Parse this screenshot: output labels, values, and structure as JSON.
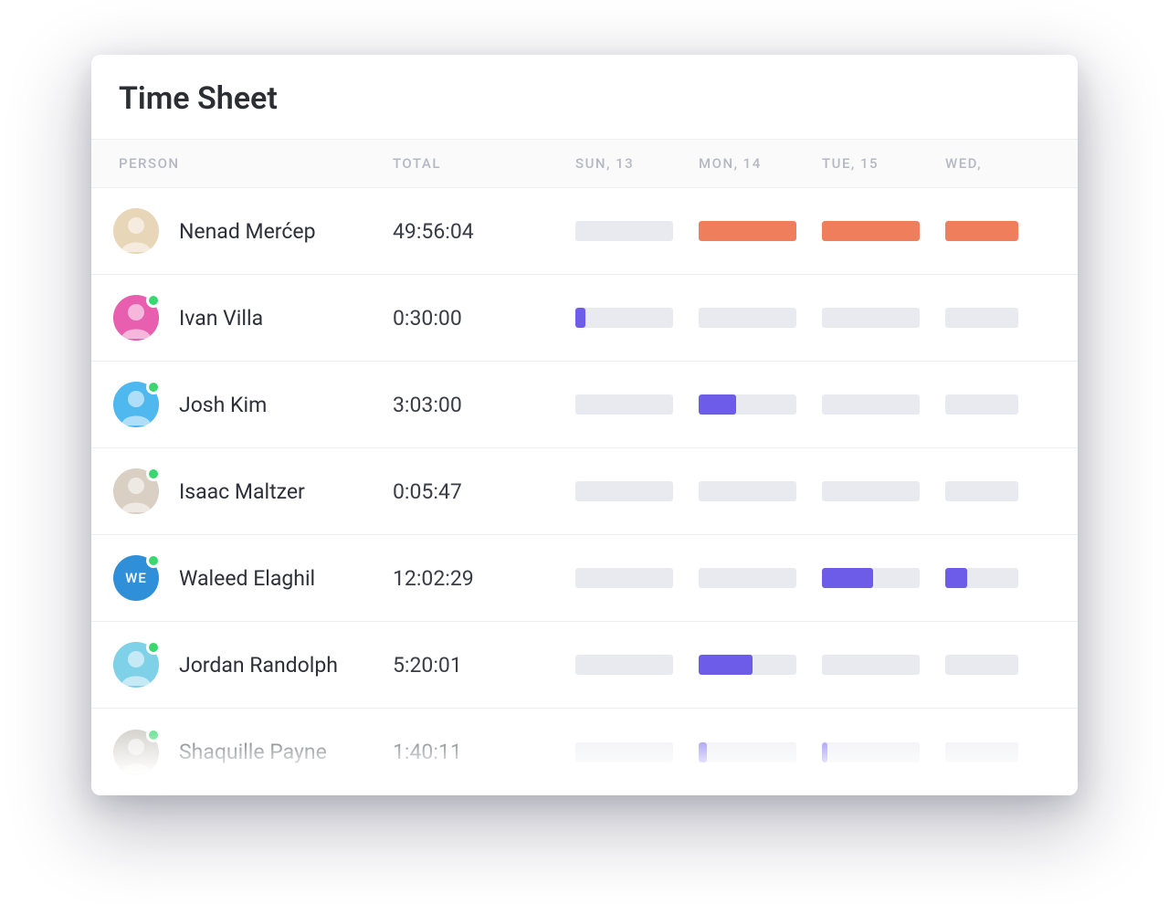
{
  "title": "Time Sheet",
  "columns": {
    "person": "PERSON",
    "total": "TOTAL",
    "days": [
      "SUN, 13",
      "MON, 14",
      "TUE, 15",
      "WED,"
    ]
  },
  "colors": {
    "orange": "#ee7e5c",
    "purple": "#6c5ce7",
    "track": "#e9eaf0",
    "presence": "#3ad66f"
  },
  "rows": [
    {
      "name": "Nenad Merćep",
      "total": "49:56:04",
      "avatar": {
        "type": "photo",
        "bg": "#e8d6b8",
        "initials": ""
      },
      "presence": false,
      "bars": [
        {
          "fill": 0,
          "color": "purple"
        },
        {
          "fill": 100,
          "color": "orange"
        },
        {
          "fill": 100,
          "color": "orange"
        },
        {
          "fill": 100,
          "color": "orange"
        }
      ]
    },
    {
      "name": "Ivan Villa",
      "total": "0:30:00",
      "avatar": {
        "type": "photo",
        "bg": "#e85fb0",
        "initials": ""
      },
      "presence": true,
      "bars": [
        {
          "fill": 10,
          "color": "purple"
        },
        {
          "fill": 0,
          "color": "purple"
        },
        {
          "fill": 0,
          "color": "purple"
        },
        {
          "fill": 0,
          "color": "purple"
        }
      ]
    },
    {
      "name": "Josh Kim",
      "total": "3:03:00",
      "avatar": {
        "type": "photo",
        "bg": "#4fb9ef",
        "initials": ""
      },
      "presence": true,
      "bars": [
        {
          "fill": 0,
          "color": "purple"
        },
        {
          "fill": 38,
          "color": "purple"
        },
        {
          "fill": 0,
          "color": "purple"
        },
        {
          "fill": 0,
          "color": "purple"
        }
      ]
    },
    {
      "name": "Isaac Maltzer",
      "total": "0:05:47",
      "avatar": {
        "type": "photo",
        "bg": "#d9cfc2",
        "initials": ""
      },
      "presence": true,
      "bars": [
        {
          "fill": 0,
          "color": "purple"
        },
        {
          "fill": 0,
          "color": "purple"
        },
        {
          "fill": 0,
          "color": "purple"
        },
        {
          "fill": 0,
          "color": "purple"
        }
      ]
    },
    {
      "name": "Waleed Elaghil",
      "total": "12:02:29",
      "avatar": {
        "type": "initials",
        "bg": "#2f8fd8",
        "initials": "WE"
      },
      "presence": true,
      "bars": [
        {
          "fill": 0,
          "color": "purple"
        },
        {
          "fill": 0,
          "color": "purple"
        },
        {
          "fill": 52,
          "color": "purple"
        },
        {
          "fill": 30,
          "color": "purple"
        }
      ]
    },
    {
      "name": "Jordan Randolph",
      "total": "5:20:01",
      "avatar": {
        "type": "photo",
        "bg": "#7fd1e8",
        "initials": ""
      },
      "presence": true,
      "bars": [
        {
          "fill": 0,
          "color": "purple"
        },
        {
          "fill": 55,
          "color": "purple"
        },
        {
          "fill": 0,
          "color": "purple"
        },
        {
          "fill": 0,
          "color": "purple"
        }
      ]
    },
    {
      "name": "Shaquille Payne",
      "total": "1:40:11",
      "avatar": {
        "type": "photo",
        "bg": "#c7c3bb",
        "initials": ""
      },
      "presence": true,
      "bars": [
        {
          "fill": 0,
          "color": "purple"
        },
        {
          "fill": 8,
          "color": "purple"
        },
        {
          "fill": 6,
          "color": "purple"
        },
        {
          "fill": 0,
          "color": "purple"
        }
      ]
    }
  ]
}
